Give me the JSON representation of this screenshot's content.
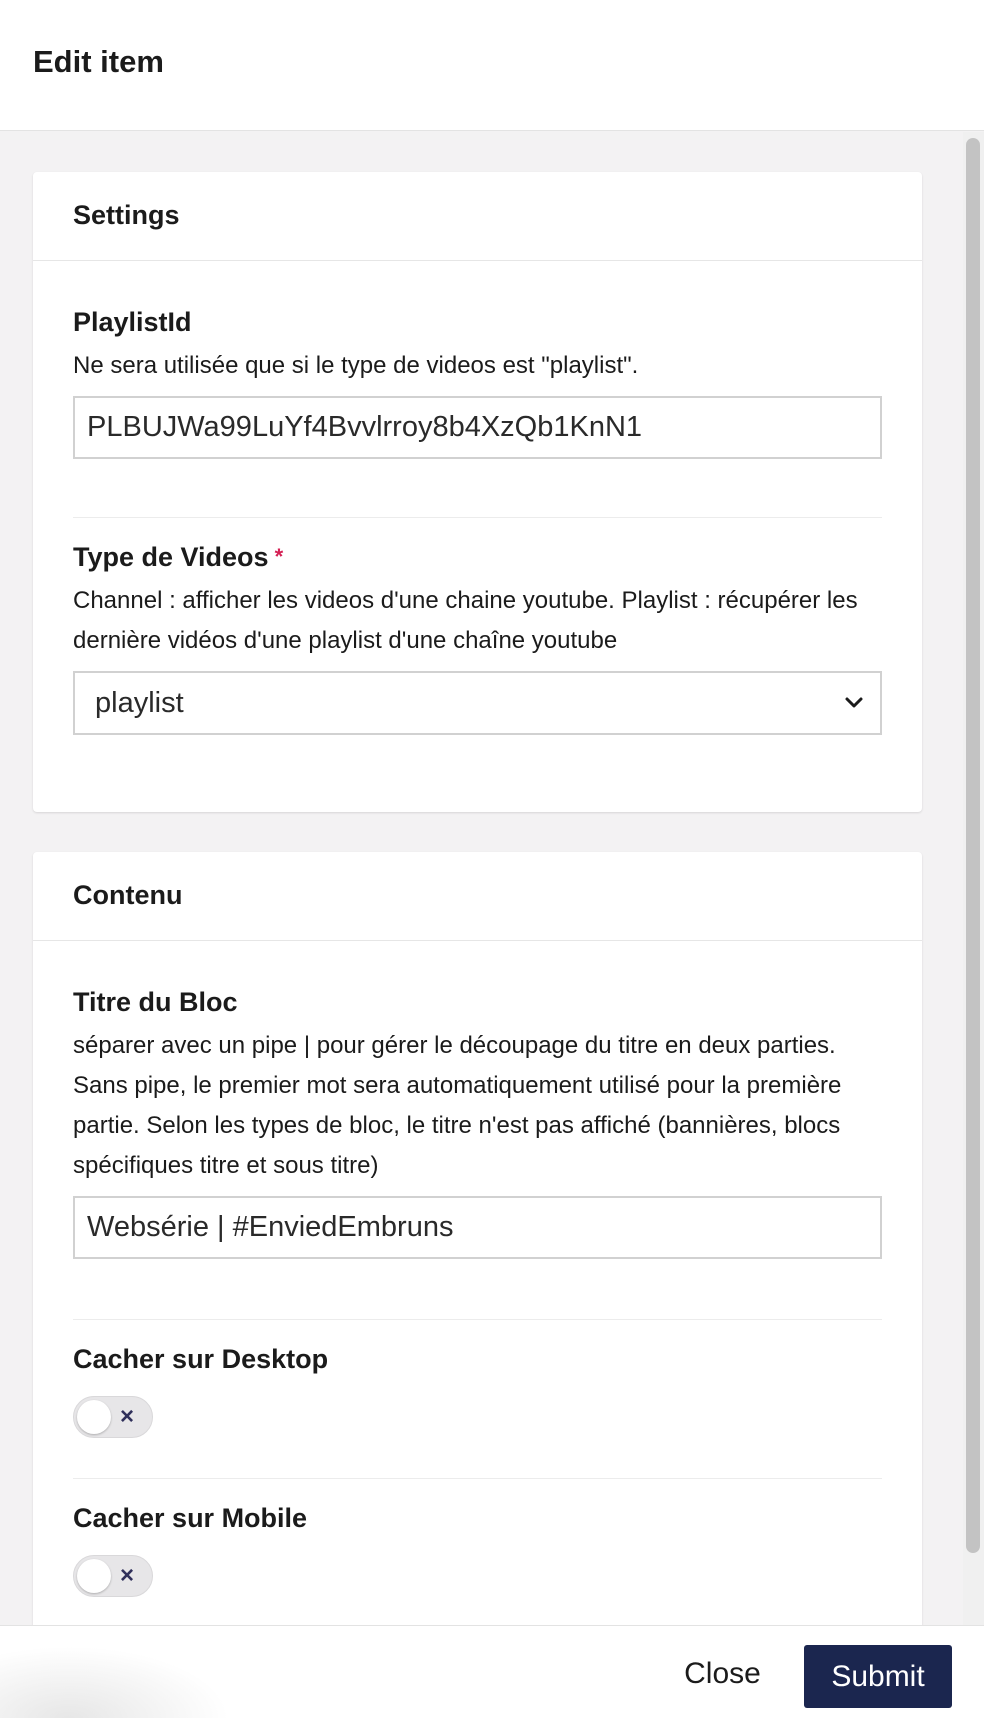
{
  "header": {
    "title": "Edit item"
  },
  "settings": {
    "title": "Settings",
    "playlist_id": {
      "label": "PlaylistId",
      "description": "Ne sera utilisée que si le type de videos est \"playlist\".",
      "value": "PLBUJWa99LuYf4Bvvlrroy8b4XzQb1KnN1"
    },
    "type_videos": {
      "label": "Type de Videos",
      "required_mark": "*",
      "description": "Channel : afficher les videos d'une chaine youtube. Playlist : récupérer les dernière vidéos d'une playlist d'une chaîne youtube",
      "selected": "playlist"
    }
  },
  "contenu": {
    "title": "Contenu",
    "titre_bloc": {
      "label": "Titre du Bloc",
      "description": "séparer avec un pipe | pour gérer le découpage du titre en deux parties. Sans pipe, le premier mot sera automatiquement utilisé pour la première partie. Selon les types de bloc, le titre n'est pas affiché (bannières, blocs spécifiques titre et sous titre)",
      "value": "Websérie | #EnviedEmbruns"
    },
    "cacher_desktop": {
      "label": "Cacher sur Desktop",
      "toggle_icon": "×",
      "enabled": false
    },
    "cacher_mobile": {
      "label": "Cacher sur Mobile",
      "toggle_icon": "×",
      "enabled": false
    }
  },
  "footer": {
    "close_label": "Close",
    "submit_label": "Submit"
  },
  "colors": {
    "submit_bg": "#1b264f",
    "required": "#d42054"
  }
}
